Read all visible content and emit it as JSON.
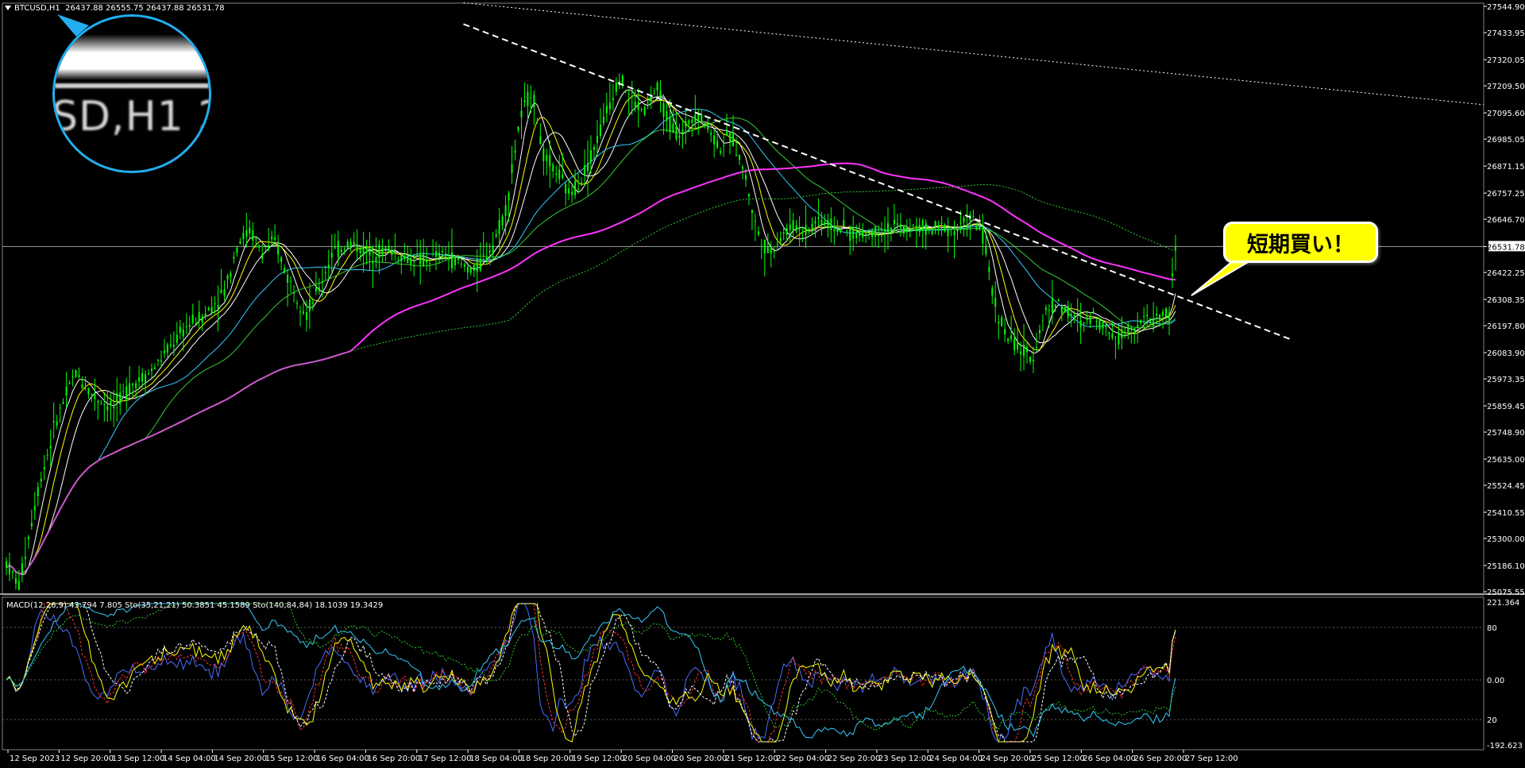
{
  "header": {
    "symbol": "BTCUSD,H1",
    "ohlc": "26437.88 26555.75 26437.88 26531.78"
  },
  "indicator_header": "MACD(12,26,9) 43.794 7.805  Sto(35,21,21) 50.3851 45.1589  Sto(140,84,84) 18.1039 19.3429",
  "magnifier": {
    "text": "SD,H1  2"
  },
  "callout": {
    "text": "短期買い！"
  },
  "colors": {
    "background": "#000000",
    "candle": "#00ff00",
    "axis_text": "#ffffff",
    "grid": "#333333",
    "callout_bg": "#ffff00",
    "magnifier_border": "#22aef0",
    "ma_magenta": "#ff33ff",
    "ma_white": "#ffffff",
    "ma_yellow": "#ffff00",
    "ma_cyan": "#33ccff",
    "ma_green": "#33cc33"
  },
  "chart_data": {
    "type": "candlestick",
    "price_axis": {
      "ticks": [
        "27544.90",
        "27433.95",
        "27320.05",
        "27209.50",
        "27095.60",
        "26985.05",
        "26871.15",
        "26757.25",
        "26646.70",
        "26531.78",
        "26422.25",
        "26308.35",
        "26197.80",
        "26083.90",
        "25973.35",
        "25859.45",
        "25748.90",
        "25635.00",
        "25524.45",
        "25410.55",
        "25300.00",
        "25186.10",
        "25075.55"
      ],
      "current_price": "26531.78",
      "ylim": [
        25075.55,
        27544.9
      ]
    },
    "time_axis": {
      "ticks": [
        "12 Sep 2023",
        "12 Sep 20:00",
        "13 Sep 12:00",
        "14 Sep 04:00",
        "14 Sep 20:00",
        "15 Sep 12:00",
        "16 Sep 04:00",
        "16 Sep 20:00",
        "17 Sep 12:00",
        "18 Sep 04:00",
        "18 Sep 20:00",
        "19 Sep 12:00",
        "20 Sep 04:00",
        "20 Sep 20:00",
        "21 Sep 12:00",
        "22 Sep 04:00",
        "22 Sep 20:00",
        "23 Sep 12:00",
        "24 Sep 04:00",
        "24 Sep 20:00",
        "25 Sep 12:00",
        "26 Sep 04:00",
        "26 Sep 20:00",
        "27 Sep 12:00"
      ]
    },
    "price_path": [
      [
        0,
        25200
      ],
      [
        2,
        25100
      ],
      [
        5,
        25500
      ],
      [
        8,
        25800
      ],
      [
        11,
        26000
      ],
      [
        14,
        25900
      ],
      [
        17,
        25850
      ],
      [
        20,
        25950
      ],
      [
        23,
        26000
      ],
      [
        26,
        26100
      ],
      [
        29,
        26200
      ],
      [
        32,
        26250
      ],
      [
        35,
        26350
      ],
      [
        37,
        26550
      ],
      [
        39,
        26600
      ],
      [
        41,
        26500
      ],
      [
        43,
        26550
      ],
      [
        45,
        26400
      ],
      [
        47,
        26300
      ],
      [
        48,
        26250
      ],
      [
        50,
        26350
      ],
      [
        52,
        26500
      ],
      [
        55,
        26550
      ],
      [
        58,
        26500
      ],
      [
        61,
        26520
      ],
      [
        64,
        26480
      ],
      [
        67,
        26470
      ],
      [
        70,
        26500
      ],
      [
        73,
        26450
      ],
      [
        75,
        26430
      ],
      [
        78,
        26550
      ],
      [
        80,
        26700
      ],
      [
        82,
        27050
      ],
      [
        84,
        27200
      ],
      [
        86,
        26900
      ],
      [
        88,
        26850
      ],
      [
        90,
        26750
      ],
      [
        92,
        26820
      ],
      [
        94,
        26950
      ],
      [
        96,
        27100
      ],
      [
        98,
        27250
      ],
      [
        100,
        27150
      ],
      [
        102,
        27100
      ],
      [
        104,
        27200
      ],
      [
        106,
        27050
      ],
      [
        108,
        27000
      ],
      [
        110,
        27100
      ],
      [
        112,
        27050
      ],
      [
        114,
        26950
      ],
      [
        116,
        27000
      ],
      [
        118,
        26850
      ],
      [
        120,
        26600
      ],
      [
        122,
        26500
      ],
      [
        124,
        26580
      ],
      [
        126,
        26620
      ],
      [
        128,
        26600
      ],
      [
        130,
        26650
      ],
      [
        132,
        26620
      ],
      [
        134,
        26600
      ],
      [
        136,
        26580
      ],
      [
        138,
        26590
      ],
      [
        140,
        26600
      ],
      [
        142,
        26620
      ],
      [
        144,
        26600
      ],
      [
        146,
        26610
      ],
      [
        148,
        26600
      ],
      [
        150,
        26620
      ],
      [
        152,
        26600
      ],
      [
        154,
        26650
      ],
      [
        156,
        26600
      ],
      [
        158,
        26300
      ],
      [
        160,
        26150
      ],
      [
        162,
        26100
      ],
      [
        164,
        26050
      ],
      [
        166,
        26250
      ],
      [
        168,
        26300
      ],
      [
        170,
        26250
      ],
      [
        172,
        26200
      ],
      [
        174,
        26250
      ],
      [
        176,
        26180
      ],
      [
        178,
        26150
      ],
      [
        180,
        26200
      ],
      [
        182,
        26220
      ],
      [
        184,
        26230
      ],
      [
        186,
        26250
      ],
      [
        187,
        26530
      ]
    ],
    "dashed_trendlines": [
      {
        "from": [
          "18 Sep 20:00",
          27560
        ],
        "to": [
          "27 Sep 12:00",
          27130
        ]
      },
      {
        "from": [
          "18 Sep 20:00",
          27470
        ],
        "to": [
          "27 Sep 12:00",
          26140
        ]
      }
    ],
    "macd_axis": {
      "ticks": [
        "221.364",
        "80",
        "0.00",
        "20",
        "-192.623"
      ]
    }
  }
}
